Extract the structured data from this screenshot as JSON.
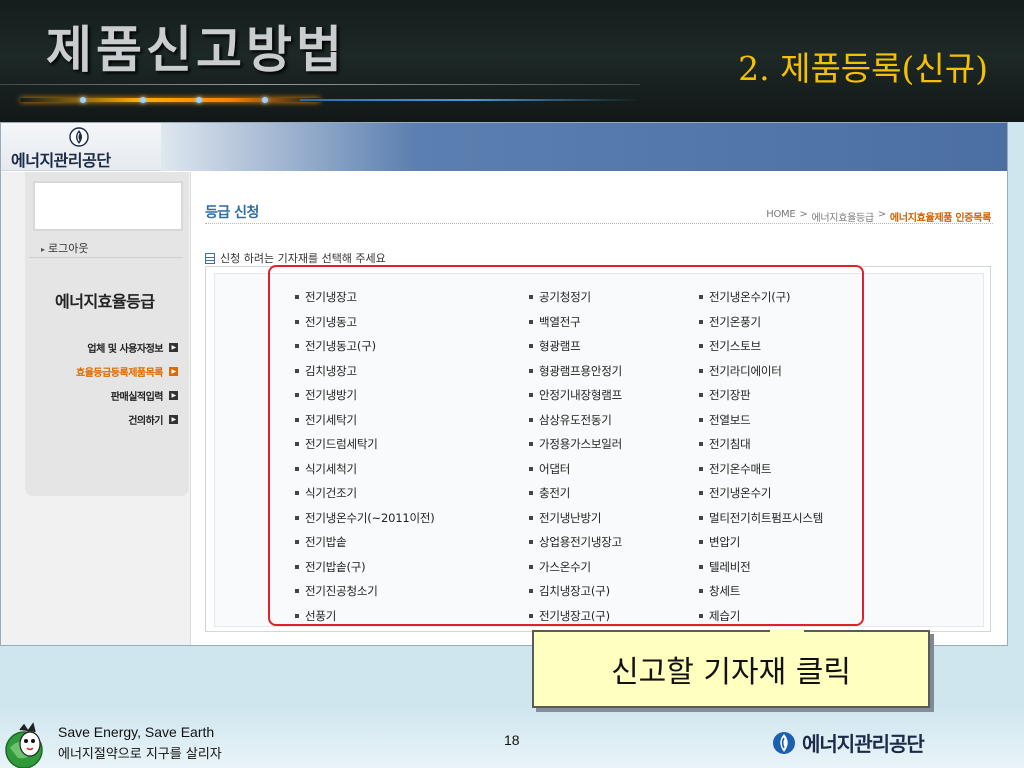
{
  "slide": {
    "title": "제품신고방법",
    "subtitle": "2. 제품등록(신규)",
    "page_number": "18"
  },
  "site": {
    "logo_text": "에너지관리공단",
    "logout_label": "로그아웃",
    "section_heading": "에너지효율등급",
    "left_menu": [
      {
        "label": "업체 및 사용자정보",
        "active": false
      },
      {
        "label": "효율등급등록제품목록",
        "active": true
      },
      {
        "label": "판매실적입력",
        "active": false
      },
      {
        "label": "건의하기",
        "active": false
      }
    ],
    "content_title": "등급 신청",
    "breadcrumb": [
      "HOME",
      ">",
      "에너지효율등급",
      ">",
      "에너지효율제품 인증목록"
    ],
    "instruction": "신청 하려는 기자재를 선택해 주세요",
    "device_columns": [
      [
        "전기냉장고",
        "전기냉동고",
        "전기냉동고(구)",
        "김치냉장고",
        "전기냉방기",
        "전기세탁기",
        "전기드럼세탁기",
        "식기세척기",
        "식기건조기",
        "전기냉온수기(~2011이전)",
        "전기밥솥",
        "전기밥솥(구)",
        "전기진공청소기",
        "선풍기"
      ],
      [
        "공기청정기",
        "백열전구",
        "형광램프",
        "형광램프용안정기",
        "안정기내장형램프",
        "삼상유도전동기",
        "가정용가스보일러",
        "어댑터",
        "충전기",
        "전기냉난방기",
        "상업용전기냉장고",
        "가스온수기",
        "김치냉장고(구)",
        "전기냉장고(구)"
      ],
      [
        "전기냉온수기(구)",
        "전기온풍기",
        "전기스토브",
        "전기라디에이터",
        "전기장판",
        "전열보드",
        "전기침대",
        "전기온수매트",
        "전기냉온수기",
        "멀티전기히트펌프시스템",
        "변압기",
        "텔레비전",
        "창세트",
        "제습기"
      ]
    ]
  },
  "callout": {
    "text": "신고할 기자재 클릭"
  },
  "footer": {
    "slogan_en": "Save Energy, Save Earth",
    "slogan_ko": "에너지절약으로 지구를 살리자",
    "logo_text": "에너지관리공단"
  },
  "colors": {
    "title_accent": "#f5c000",
    "highlight_red": "#e0202a",
    "active_menu": "#e06a00",
    "content_title": "#2f6da5",
    "callout_fill": "#ffffc0"
  },
  "icons": [
    "energy-emblem-icon",
    "document-icon",
    "menu-arrow-icon",
    "mascot-icon"
  ]
}
